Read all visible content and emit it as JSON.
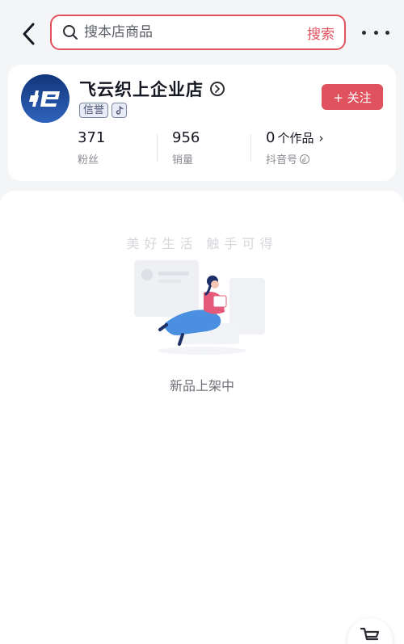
{
  "search": {
    "placeholder": "搜本店商品",
    "button_label": "搜索"
  },
  "shop": {
    "name": "飞云织上企业店",
    "badge_credit": "信誉",
    "follow_label": "+ 关注",
    "stats": {
      "fans_value": "371",
      "fans_label": "粉丝",
      "sales_value": "956",
      "sales_label": "销量",
      "works_value": "0",
      "works_unit": "个作品",
      "works_label": "抖音号"
    }
  },
  "content": {
    "slogan": "美好生活 触手可得",
    "empty_text": "新品上架中"
  },
  "colors": {
    "accent": "#e0525e",
    "logo_bg": "#1e4fa3"
  },
  "icons": {
    "back": "chevron-left-icon",
    "search": "search-icon",
    "more": "more-icon",
    "cart": "cart-icon"
  }
}
